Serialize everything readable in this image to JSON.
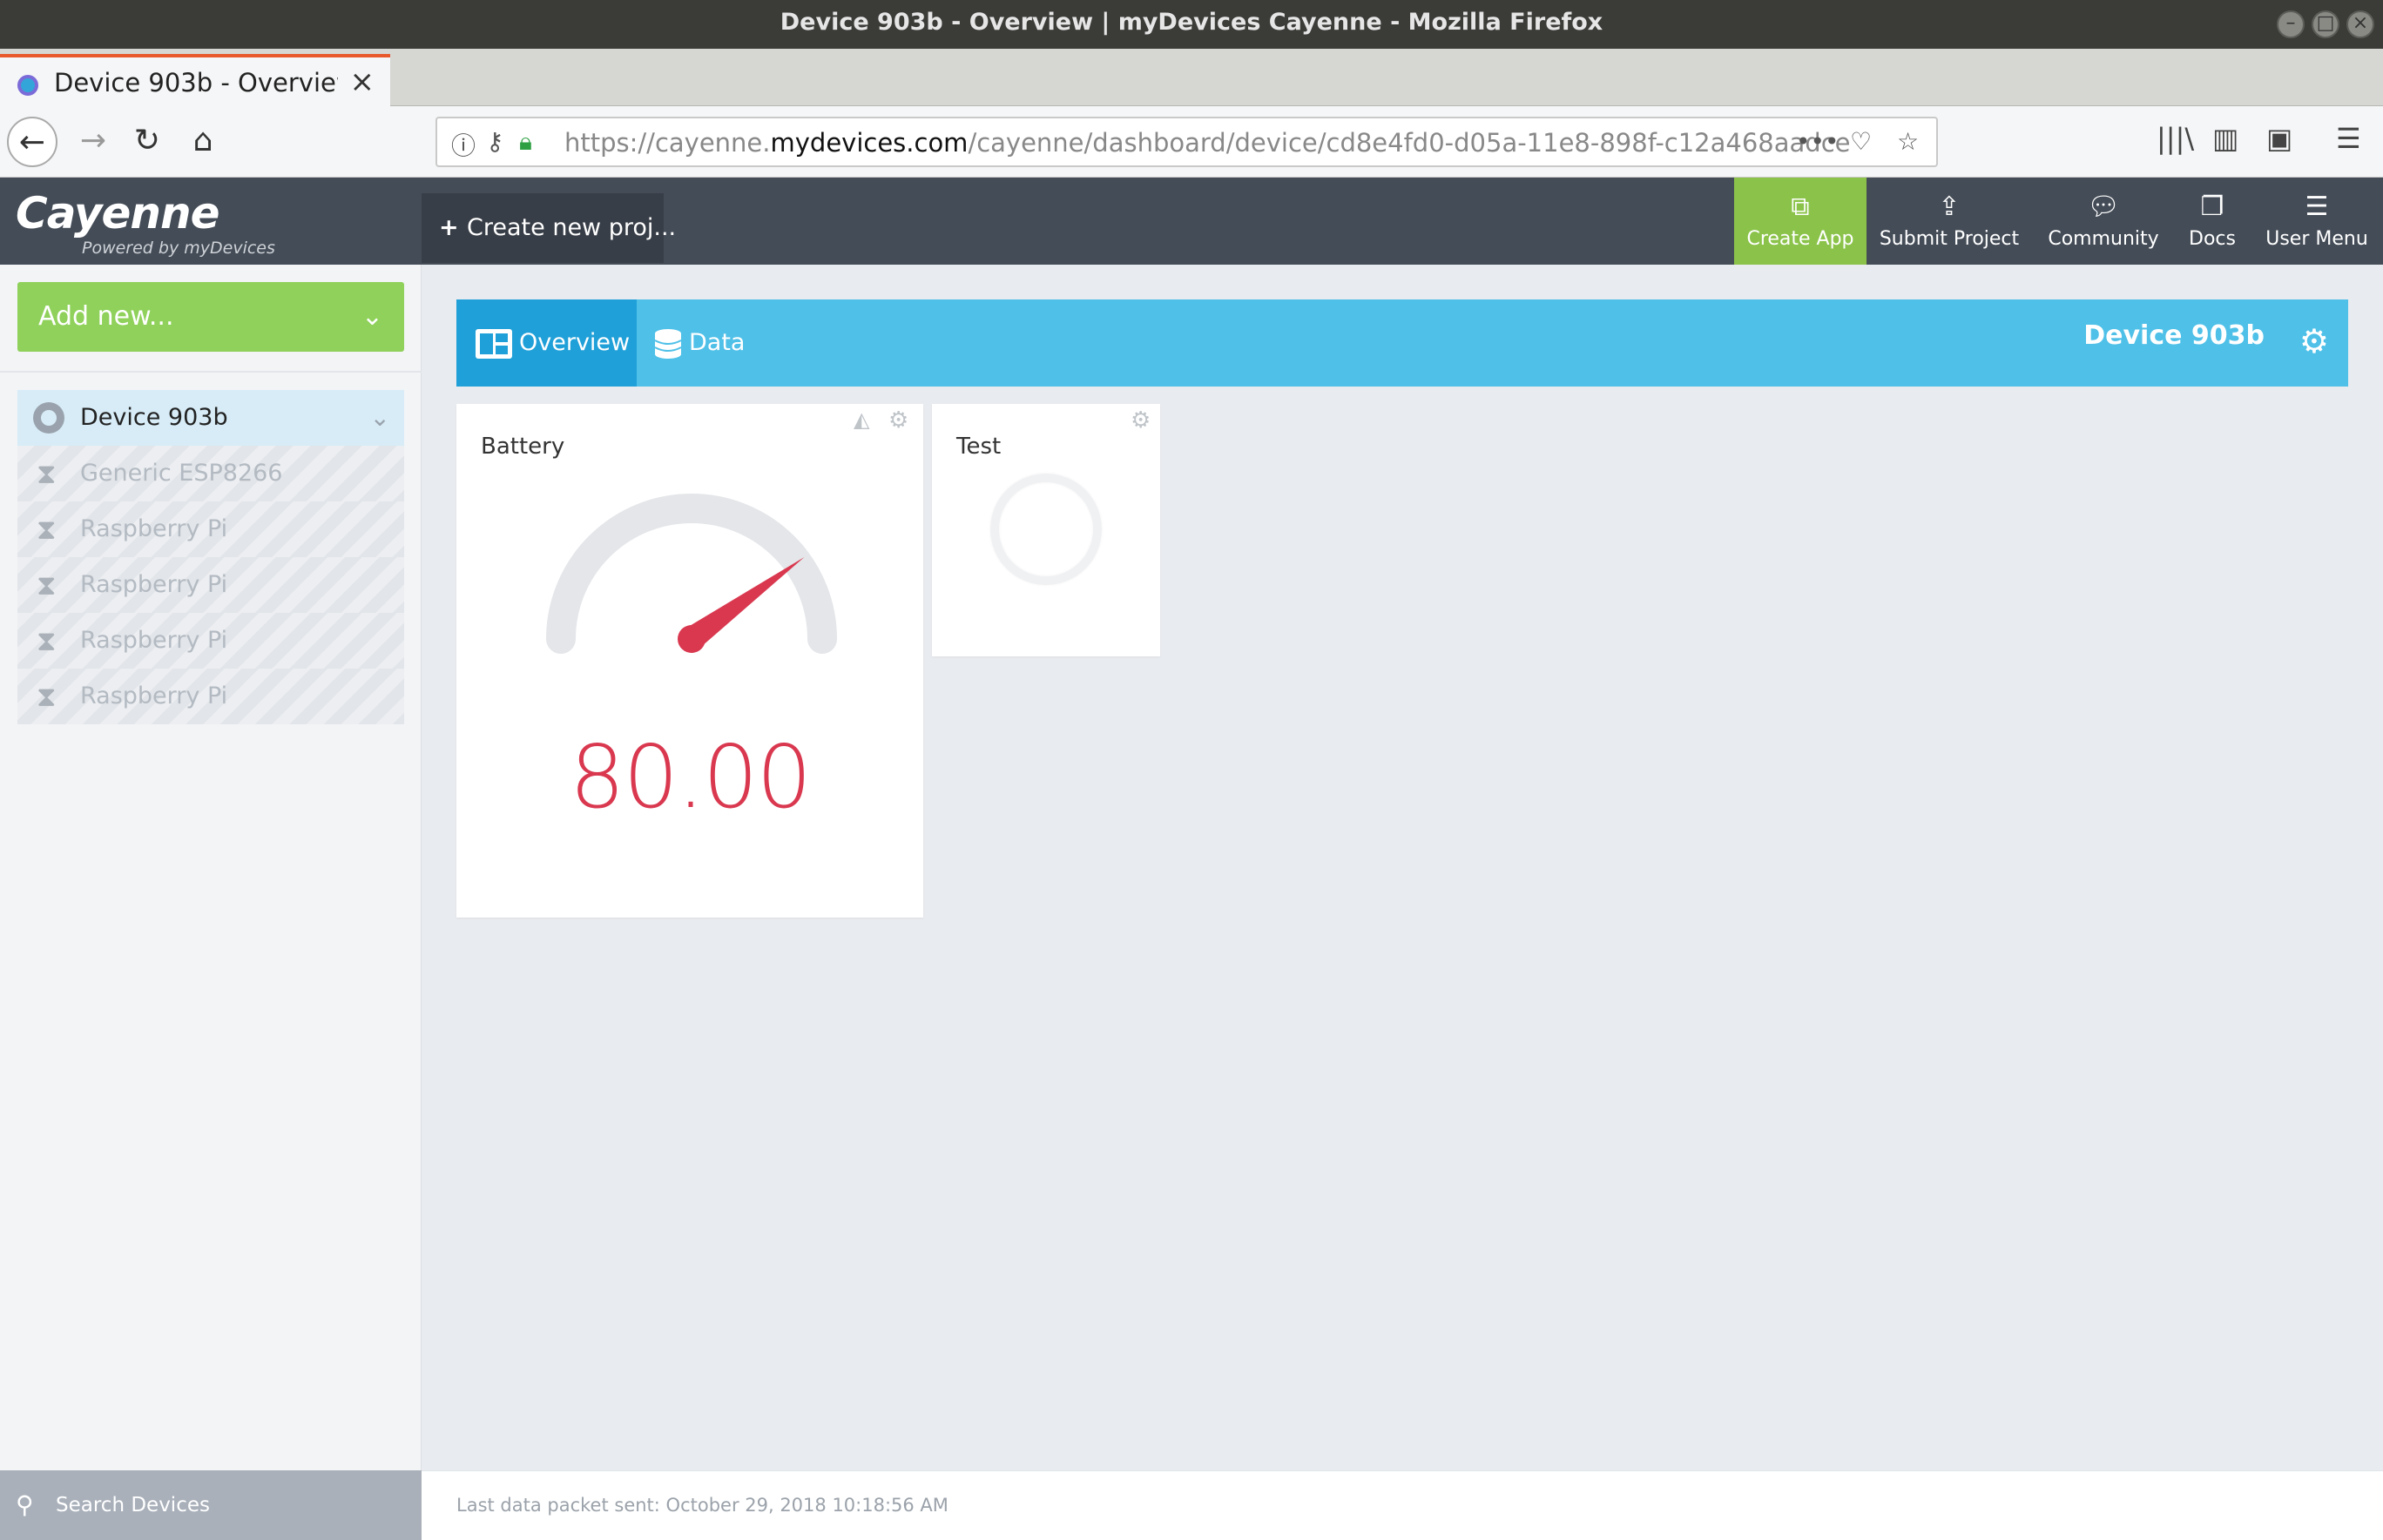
{
  "window": {
    "title": "Device 903b - Overview | myDevices Cayenne - Mozilla Firefox"
  },
  "browser": {
    "tab_title": "Device 903b - Overview",
    "url_prefix": "https://cayenne.",
    "url_domain": "mydevices.com",
    "url_path": "/cayenne/dashboard/device/cd8e4fd0-d05a-11e8-898f-c12a468aadce"
  },
  "header": {
    "logo": "Cayenne",
    "logo_sub": "Powered by myDevices",
    "create_project": "Create new proj...",
    "nav": {
      "create_app": "Create App",
      "submit_project": "Submit Project",
      "community": "Community",
      "docs": "Docs",
      "user_menu": "User Menu"
    },
    "accent_color": "#8bc34a"
  },
  "sidebar": {
    "add_new": "Add new...",
    "devices": [
      {
        "name": "Device 903b",
        "state": "active"
      },
      {
        "name": "Generic ESP8266",
        "state": "pending"
      },
      {
        "name": "Raspberry Pi",
        "state": "pending"
      },
      {
        "name": "Raspberry Pi",
        "state": "pending"
      },
      {
        "name": "Raspberry Pi",
        "state": "pending"
      },
      {
        "name": "Raspberry Pi",
        "state": "pending"
      }
    ],
    "search_placeholder": "Search Devices"
  },
  "device": {
    "title": "Device 903b",
    "tabs": {
      "overview": "Overview",
      "data": "Data"
    },
    "bar_color": "#4fc0e8"
  },
  "widgets": {
    "battery": {
      "title": "Battery",
      "value": "80.00",
      "gauge_fraction": 0.8,
      "color": "#d9384f"
    },
    "test": {
      "title": "Test"
    }
  },
  "footer": {
    "last_packet": "Last data packet sent: October 29, 2018 10:18:56 AM"
  }
}
